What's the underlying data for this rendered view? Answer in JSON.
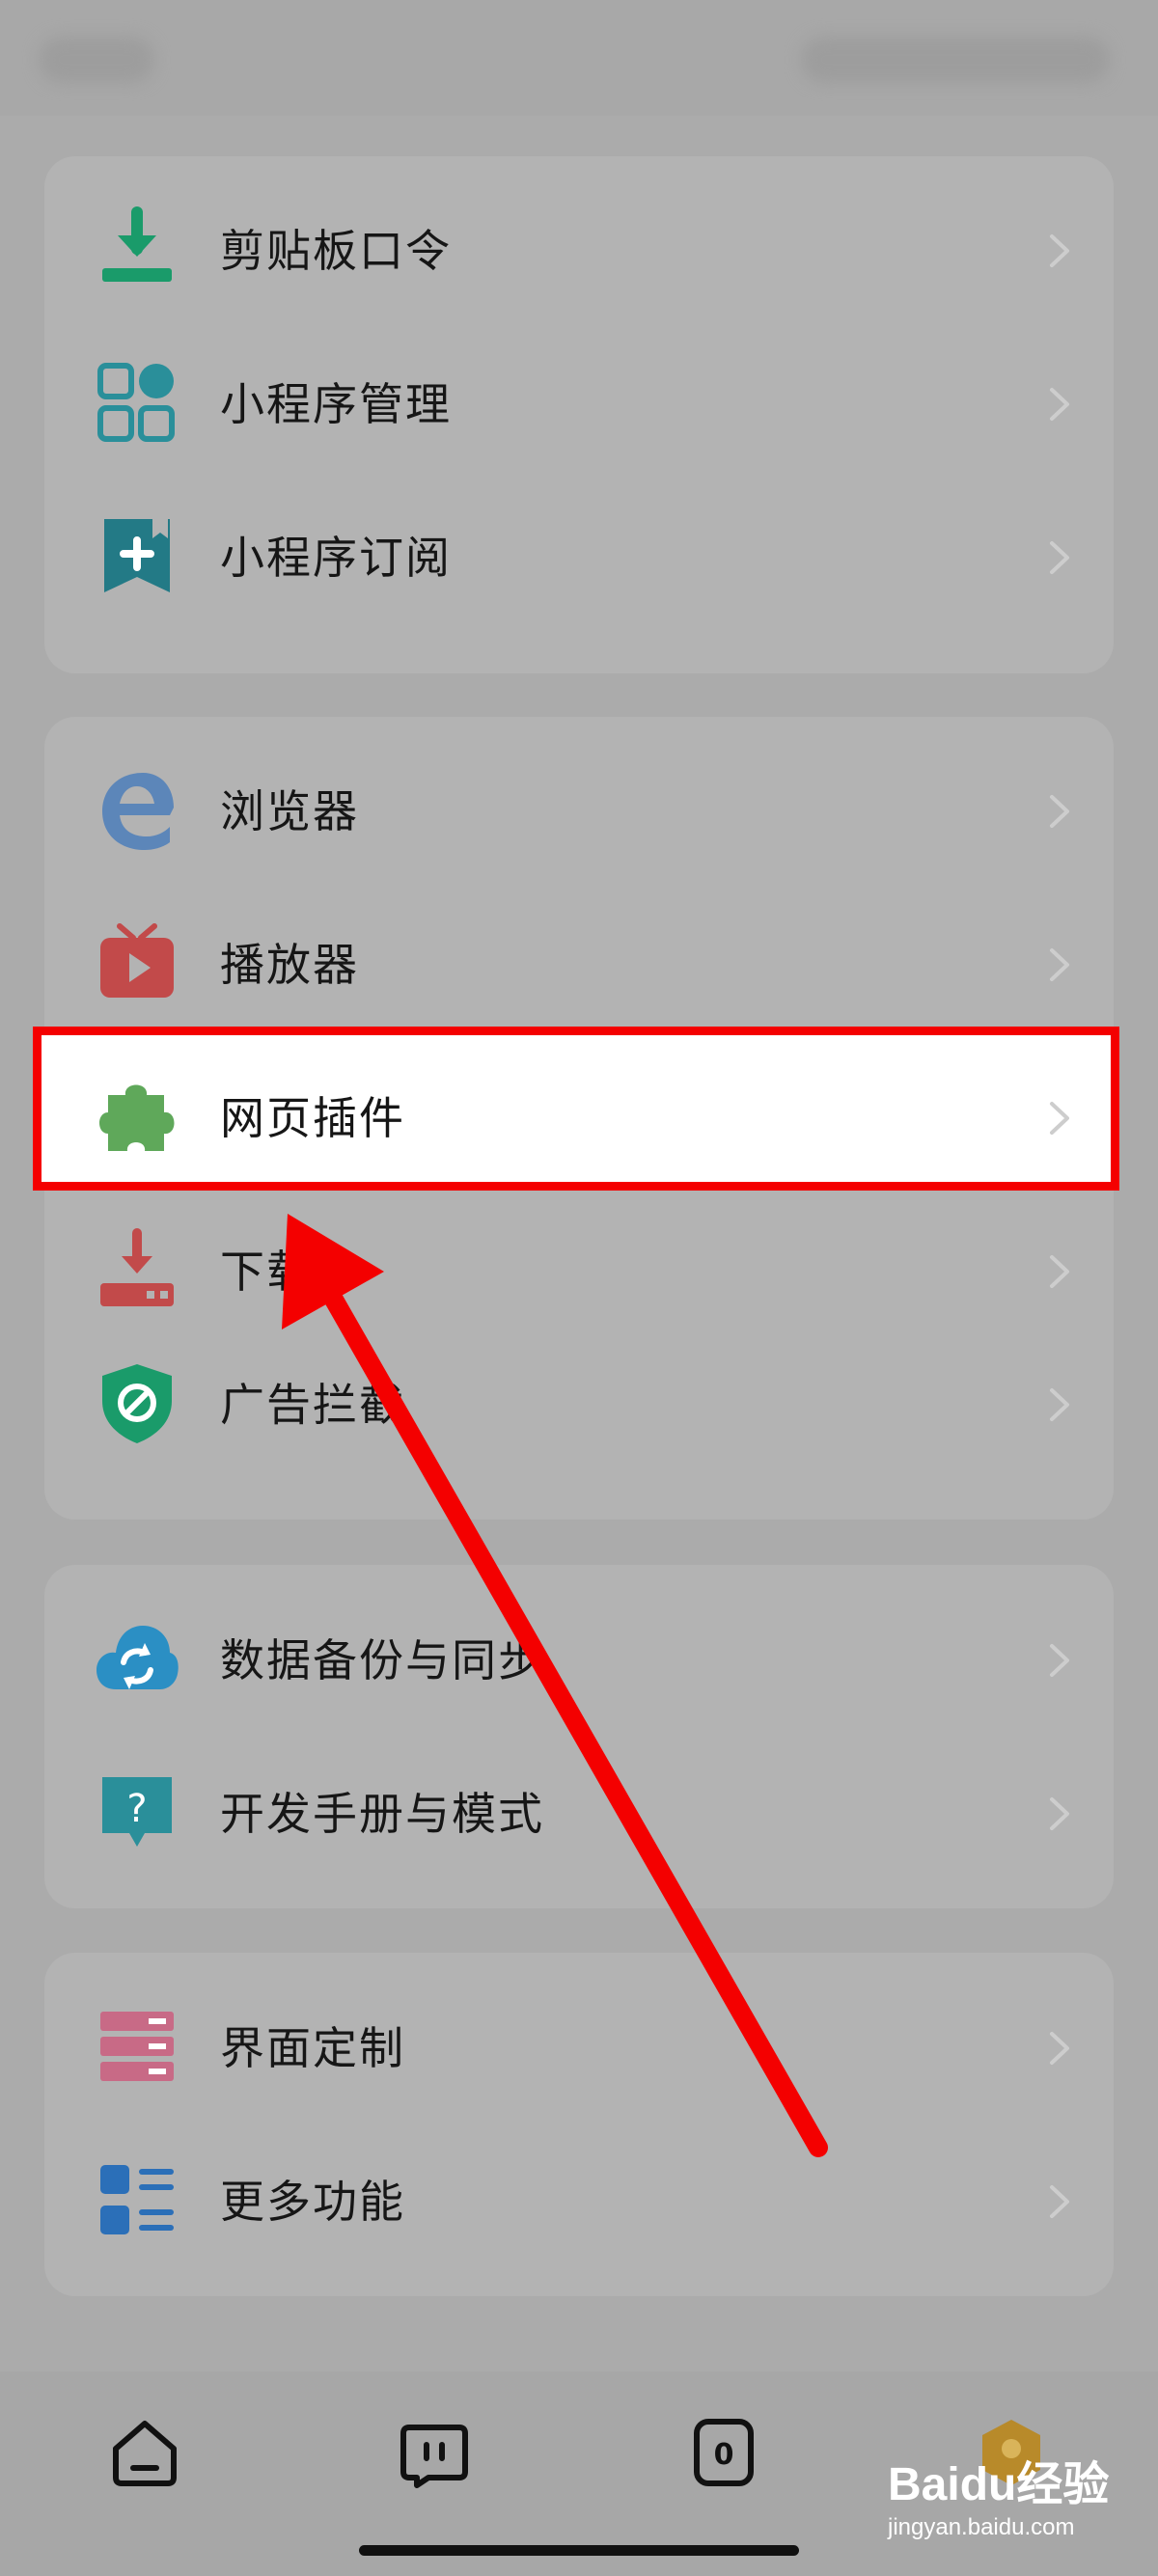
{
  "groups": [
    {
      "items": [
        {
          "label": "剪贴板口令",
          "icon": "clipboard-download-icon"
        },
        {
          "label": "小程序管理",
          "icon": "apps-grid-icon"
        },
        {
          "label": "小程序订阅",
          "icon": "bookmark-plus-icon"
        }
      ]
    },
    {
      "items": [
        {
          "label": "浏览器",
          "icon": "browser-e-icon"
        },
        {
          "label": "播放器",
          "icon": "tv-play-icon"
        },
        {
          "label": "网页插件",
          "icon": "puzzle-icon"
        },
        {
          "label": "下载",
          "icon": "download-tray-icon"
        },
        {
          "label": "广告拦截",
          "icon": "shield-block-icon"
        }
      ]
    },
    {
      "items": [
        {
          "label": "数据备份与同步",
          "icon": "cloud-sync-icon"
        },
        {
          "label": "开发手册与模式",
          "icon": "help-bubble-icon"
        }
      ]
    },
    {
      "items": [
        {
          "label": "界面定制",
          "icon": "layout-stack-icon"
        },
        {
          "label": "更多功能",
          "icon": "list-more-icon"
        }
      ]
    }
  ],
  "navbar": {
    "tab_count": "0",
    "items": [
      "home-icon",
      "smile-icon",
      "tabs-icon",
      "profile-icon"
    ]
  },
  "watermark": {
    "logo": "Baidu经验",
    "url": "jingyan.baidu.com"
  },
  "colors": {
    "highlight_border": "#f40000",
    "arrow": "#f40000",
    "green": "#1a9b6a",
    "teal": "#2a8f9a",
    "blue": "#5c86b9",
    "red": "#c24a4a",
    "lime": "#5fa85a",
    "pink": "#c86a86"
  }
}
